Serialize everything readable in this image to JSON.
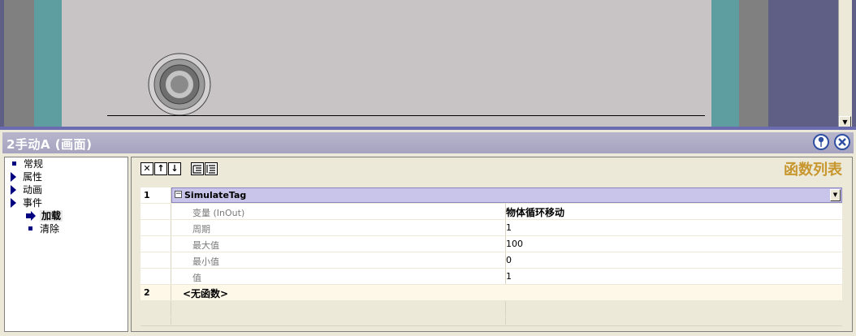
{
  "window": {
    "title": "2手动A (画面)"
  },
  "tree": {
    "items": [
      {
        "label": "常规",
        "icon": "bullet-icon"
      },
      {
        "label": "属性",
        "icon": "expand-arrow-icon"
      },
      {
        "label": "动画",
        "icon": "expand-arrow-icon"
      },
      {
        "label": "事件",
        "icon": "expand-arrow-icon"
      },
      {
        "label": "加载",
        "icon": "selected-arrow-icon",
        "selected": true
      },
      {
        "label": "清除",
        "icon": "bullet-icon"
      }
    ]
  },
  "toolbar": {
    "buttons": [
      "delete-icon",
      "move-up-icon",
      "move-down-icon",
      "indent-icon",
      "list-icon"
    ]
  },
  "function_list": {
    "title": "函数列表",
    "rows": [
      {
        "index": "1",
        "function": "SimulateTag",
        "params": [
          {
            "name": "变量 (InOut)",
            "value": "物体循环移动"
          },
          {
            "name": "周期",
            "value": "1"
          },
          {
            "name": "最大值",
            "value": "100"
          },
          {
            "name": "最小值",
            "value": "0"
          },
          {
            "name": "值",
            "value": "1"
          }
        ]
      },
      {
        "index": "2",
        "function": "<无函数>"
      }
    ]
  },
  "colors": {
    "accent_title": "#c8962e",
    "selected_function_row": "#c9c5ea",
    "teal_strip": "#5f9ea0"
  }
}
